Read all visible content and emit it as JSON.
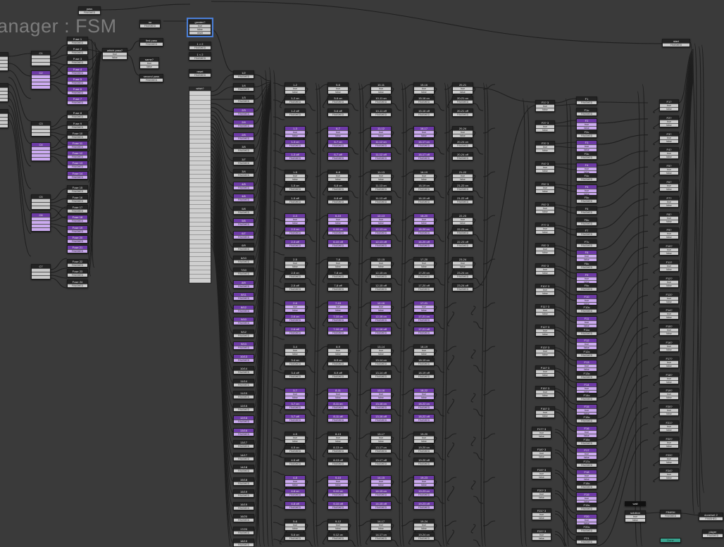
{
  "title": "anager : FSM",
  "events": {
    "finished": "FINISHED",
    "true": "true",
    "false": "false",
    "reset": "reset"
  },
  "top_nodes": {
    "pass": "pass",
    "no": "no",
    "first_pass": "first pass",
    "second_pass": "second pass",
    "which_pass": "which pass?",
    "same": "same?",
    "greater": "greater?",
    "one_gt_two": "1 > 2",
    "one_lt_two": "1 < 2",
    "reset": "reset",
    "which": "which?",
    "start_right": "start",
    "wait": "wait",
    "solution": "solution",
    "finish": "FINISH",
    "chosen": "chosen",
    "done_2": "done/set 2",
    "player": "player",
    "done": "Done"
  },
  "left_groups": [
    "C1",
    "C2",
    "C3",
    "C4",
    "C5",
    "C6",
    "C7"
  ],
  "fuse_labels": [
    "Fuse 1",
    "Fuse 2",
    "Fuse 3",
    "Fuse 4",
    "Fuse 5",
    "Fuse 6",
    "Fuse 7",
    "Fuse 8",
    "Fuse 9",
    "Fuse 10",
    "Fuse 11",
    "Fuse 12",
    "Fuse 13",
    "Fuse 14",
    "Fuse 15",
    "Fuse 16",
    "Fuse 17",
    "Fuse 18",
    "Fuse 19",
    "Fuse 20",
    "Fuse 21",
    "Fuse 22",
    "Fuse 23",
    "Fuse 24"
  ],
  "pair_column": [
    "1/2",
    "1/4",
    "1/3",
    "2/3",
    "2/4",
    "2/5",
    "3/5",
    "3/7",
    "3/4",
    "4/5",
    "4/6",
    "5/8",
    "5/6",
    "6/7",
    "6/9",
    "6/10",
    "7/10",
    "8/9",
    "8/11",
    "8/12",
    "9/10",
    "9/12",
    "9/13",
    "10/13",
    "10/14",
    "11/14",
    "11/15",
    "12/15",
    "12/16",
    "13/16",
    "13/17",
    "14/17",
    "14/18",
    "15/18",
    "15/19",
    "16/19",
    "16/20",
    "17/20",
    "18/19",
    "18/20"
  ],
  "grid_columns": [
    [
      "1-2",
      "1-2 on",
      "1-2 off",
      "1-3",
      "1-3 on",
      "1-3 off",
      "1-5",
      "1-5 on",
      "1-5 off",
      "2-3",
      "2-3 on",
      "2-3 off",
      "2-5",
      "2-5 on",
      "2-5 off",
      "2-6",
      "2-6 on",
      "2-6 off",
      "3-4",
      "3-4 on",
      "3-4 off",
      "3-7",
      "3-7 on",
      "3-7 off",
      "4-5",
      "4-5 on",
      "4-5 off",
      "4-8",
      "4-8 on",
      "4-8 off",
      "5-6",
      "5-6 on"
    ],
    [
      "5-6",
      "5-6 on",
      "5-6 off",
      "6-7",
      "6-7 on",
      "6-7 off",
      "6-8",
      "6-8 on",
      "6-8 off",
      "6-10",
      "6-10 on",
      "6-10 off",
      "7-8",
      "7-8 on",
      "7-8 off",
      "7-10",
      "7-10 on",
      "7-10 off",
      "8-9",
      "8-9 on",
      "8-9 off",
      "8-11",
      "8-11 on",
      "8-11 off",
      "8-13",
      "8-13 on",
      "8-13 off",
      "9-10",
      "9-10 on",
      "9-10 off",
      "9-12",
      "9-12 on",
      "9-12 off",
      "9-13",
      "9-13 on"
    ],
    [
      "10-11",
      "10-11 on",
      "10-11 off",
      "11-12",
      "11-12 on",
      "11-12 off",
      "11-13",
      "11-13 on",
      "11-13 off",
      "12-13",
      "12-13 on",
      "12-13 off",
      "12-15",
      "12-15 on",
      "12-15 off",
      "12-16",
      "12-16 on",
      "12-16 off",
      "13-14",
      "13-14 on",
      "13-14 off",
      "13-16",
      "13-16 on",
      "13-16 off",
      "13-17",
      "13-17 on",
      "13-17 off",
      "14-15",
      "14-15 on",
      "14-15 off",
      "14-17",
      "14-17 on",
      "14-17 off",
      "15-16",
      "15-16 on"
    ],
    [
      "15-16",
      "15-16 on",
      "15-16 off",
      "16-17",
      "16-17 on",
      "16-17 off",
      "16-19",
      "16-19 on",
      "16-19 off",
      "16-20",
      "16-20 on",
      "16-20 off",
      "17-20",
      "17-20 on",
      "17-20 off",
      "17-21",
      "17-21 on",
      "17-21 off",
      "18-19",
      "18-19 on",
      "18-19 off",
      "18-22",
      "18-22 on",
      "18-22 off",
      "19-20",
      "19-20 on",
      "19-20 off",
      "19-23",
      "19-23 on",
      "19-23 off",
      "19-24",
      "19-24 on"
    ],
    [
      "20-21",
      "20-21 on",
      "20-21 off",
      "20-24",
      "20-24 on",
      "20-24 off",
      "21-22",
      "21-22 on",
      "21-22 off",
      "22-23",
      "22-23 on",
      "22-23 off",
      "23-24",
      "23-24 on",
      "23-24 off"
    ]
  ],
  "f_checks": [
    "F1? 3",
    "F2? 3",
    "F3? 3",
    "F4? 3",
    "F5? 3",
    "F6? 3",
    "F7? 3",
    "F8? 3",
    "F9? 3",
    "F10? 3",
    "F11? 3",
    "F12? 3",
    "F13? 3",
    "F14? 3",
    "F15? 3",
    "F16? 3",
    "F17? 3",
    "F18? 3",
    "F19? 3",
    "F20? 3",
    "F21? 3",
    "F22? 3"
  ],
  "f_column": [
    "F1",
    "F1c",
    "F2",
    "F2c",
    "F3",
    "F3c",
    "F4",
    "F4c",
    "F5",
    "F5c",
    "F6",
    "F6c",
    "F7",
    "F7c",
    "F8",
    "F8c",
    "F9",
    "F9c",
    "F10",
    "F10c",
    "F11",
    "F11c",
    "F12",
    "F12c",
    "F13",
    "F13c",
    "F14",
    "F14c",
    "F15",
    "F15c",
    "F16",
    "F16c",
    "F17",
    "F17c",
    "F18",
    "F18c",
    "F19",
    "F19c",
    "F20",
    "F20c",
    "F21"
  ],
  "f_right": [
    "F1?",
    "F2?",
    "F3?",
    "F4?",
    "F5?",
    "F6?",
    "F7?",
    "F8?",
    "F9?",
    "F10?",
    "F11?",
    "F12?",
    "F13?",
    "F14?",
    "F15?",
    "F16?",
    "F17?",
    "F18?",
    "F19?",
    "F20?",
    "F21?",
    "F22?",
    "F23?",
    "F24?"
  ],
  "colors": {
    "canvas": "#3a3a3a",
    "node": "#2a2a2a",
    "accent": "#6e3aa8",
    "event": "#c9c9c9",
    "selected_outline": "#4a7fd8",
    "wire": "#1e1e1e"
  }
}
